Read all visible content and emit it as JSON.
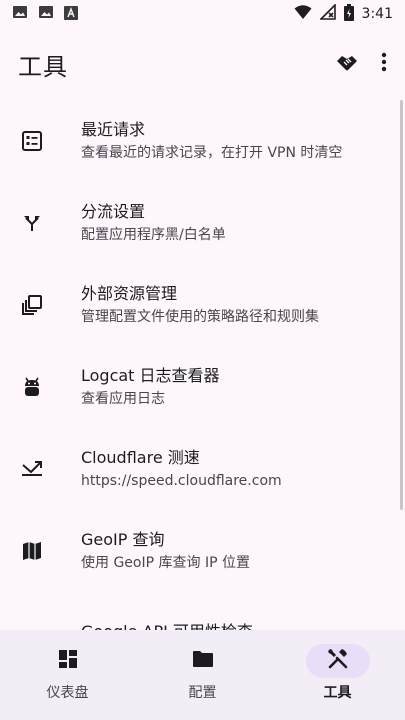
{
  "status_bar": {
    "time": "3:41",
    "icons": [
      "image-icon",
      "image-icon",
      "text-app-icon",
      "wifi-icon",
      "no-signal-icon",
      "battery-icon"
    ]
  },
  "app_bar": {
    "title": "工具",
    "actions": [
      "handshake-icon",
      "more-vert-icon"
    ]
  },
  "items": [
    {
      "icon": "request-list-icon",
      "title": "最近请求",
      "subtitle": "查看最近的请求记录，在打开 VPN 时清空"
    },
    {
      "icon": "split-arrows-icon",
      "title": "分流设置",
      "subtitle": "配置应用程序黑/白名单"
    },
    {
      "icon": "library-icon",
      "title": "外部资源管理",
      "subtitle": "管理配置文件使用的策略路径和规则集"
    },
    {
      "icon": "android-icon",
      "title": "Logcat 日志查看器",
      "subtitle": "查看应用日志"
    },
    {
      "icon": "speed-icon",
      "title": "Cloudflare 测速",
      "subtitle": "https://speed.cloudflare.com"
    },
    {
      "icon": "map-icon",
      "title": "GeoIP 查询",
      "subtitle": "使用 GeoIP 库查询 IP 位置"
    },
    {
      "icon": "api-icon",
      "title": "Google API 可用性检查",
      "subtitle": ""
    }
  ],
  "bottom_nav": {
    "items": [
      {
        "icon": "dashboard-icon",
        "label": "仪表盘",
        "active": false
      },
      {
        "icon": "folder-icon",
        "label": "配置",
        "active": false
      },
      {
        "icon": "tools-icon",
        "label": "工具",
        "active": true
      }
    ]
  },
  "colors": {
    "background": "#fdf7fb",
    "nav_background": "#f3edf5",
    "active_pill": "#e8def8"
  }
}
